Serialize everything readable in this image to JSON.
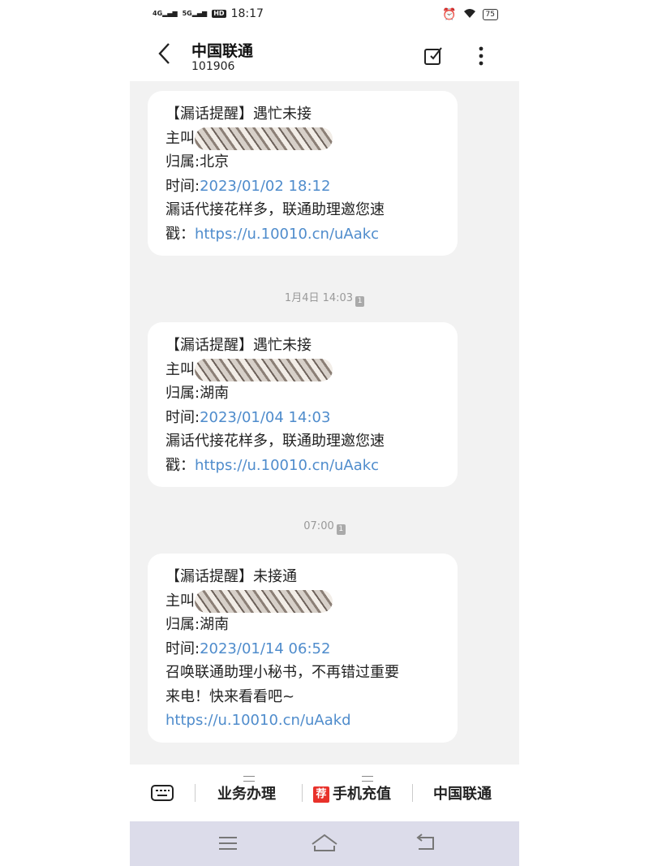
{
  "status_bar": {
    "signal1": "4G",
    "signal2": "5G",
    "hd": "HD",
    "time": "18:17",
    "battery": "75"
  },
  "header": {
    "title": "中国联通",
    "subtitle": "101906"
  },
  "messages": [
    {
      "line1": "【漏话提醒】遇忙未接",
      "caller_label": "主叫",
      "location": "归属:北京",
      "time_label": "时间:",
      "time_value": "2023/01/02 18:12",
      "body1": "漏话代接花样多，联通助理邀您速",
      "body2_prefix": "戳：",
      "link": "https://u.10010.cn/uAakc"
    },
    {
      "line1": "【漏话提醒】遇忙未接",
      "caller_label": "主叫",
      "location": "归属:湖南",
      "time_label": "时间:",
      "time_value": "2023/01/04 14:03",
      "body1": "漏话代接花样多，联通助理邀您速",
      "body2_prefix": "戳：",
      "link": "https://u.10010.cn/uAakc"
    },
    {
      "line1": "【漏话提醒】未接通",
      "caller_label": "主叫",
      "location": "归属:湖南",
      "time_label": "时间:",
      "time_value": "2023/01/14 06:52",
      "body1": "召唤联通助理小秘书，不再错过重要",
      "body2": "来电！快来看看吧~",
      "link": "https://u.10010.cn/uAakd"
    }
  ],
  "timestamps": [
    "1月4日 14:03",
    "07:00"
  ],
  "sim_badge": "1",
  "bottom_menu": {
    "item1": "业务办理",
    "rec_badge": "荐",
    "item2": "手机充值",
    "item3": "中国联通"
  },
  "icons": [
    "back-icon",
    "new-message-icon",
    "more-icon",
    "keyboard-icon",
    "nav-menu-icon",
    "nav-home-icon",
    "nav-back-icon"
  ]
}
